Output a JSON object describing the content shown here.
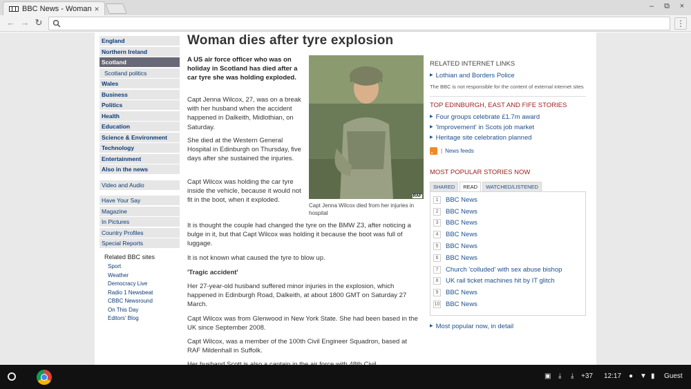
{
  "browser": {
    "tab_title": "BBC News - Woman dies after tyre explosion",
    "close_glyph": "×",
    "address": "",
    "window_controls": [
      "–",
      "⧉",
      "×"
    ]
  },
  "left_nav": {
    "sections": [
      {
        "label": "England",
        "style": "bold"
      },
      {
        "label": "Northern Ireland",
        "style": "bold"
      },
      {
        "label": "Scotland",
        "style": "active"
      },
      {
        "label": "Scotland politics",
        "style": "sub"
      },
      {
        "label": "Wales",
        "style": "bold"
      },
      {
        "label": "Business",
        "style": "bold"
      },
      {
        "label": "Politics",
        "style": "bold"
      },
      {
        "label": "Health",
        "style": "bold"
      },
      {
        "label": "Education",
        "style": "bold"
      },
      {
        "label": "Science & Environment",
        "style": "bold"
      },
      {
        "label": "Technology",
        "style": "bold"
      },
      {
        "label": "Entertainment",
        "style": "bold"
      },
      {
        "label": "Also in the news",
        "style": "bold"
      }
    ],
    "video_audio": "Video and Audio",
    "extras": [
      "Have Your Say",
      "Magazine",
      "In Pictures",
      "Country Profiles",
      "Special Reports"
    ],
    "related_head": "Related BBC sites",
    "related_sites": [
      "Sport",
      "Weather",
      "Democracy Live",
      "Radio 1 Newsbeat",
      "CBBC Newsround",
      "On This Day",
      "Editors' Blog"
    ]
  },
  "article": {
    "headline": "Woman dies after tyre explosion",
    "lead": "A US air force officer who was on holiday in Scotland has died after a car tyre she was holding exploded.",
    "paragraphs_narrow": [
      "Capt Jenna Wilcox, 27, was on a break with her husband when the accident happened in Dalkeith, Midlothian, on Saturday.",
      "She died at the Western General Hospital in Edinburgh on Thursday, five days after she sustained the injuries.",
      "Capt Wilcox was holding the car tyre inside the vehicle, because it would not fit in the boot, when it exploded."
    ],
    "paragraphs_wide": [
      "It is thought the couple had changed the tyre on the BMW Z3, after noticing a bulge in it, but that Capt Wilcox was holding it because the boot was full of luggage.",
      "It is not known what caused the tyre to blow up.",
      "'Tragic accident'",
      "Her 27-year-old husband suffered minor injuries in the explosion, which happened in Edinburgh Road, Dalkeith, at about 1800 GMT on Saturday 27 March.",
      "Capt Wilcox was from Glenwood in New York State. She had been based in the UK since September 2008.",
      "Capt Wilcox, was a member of the 100th Civil Engineer Squadron, based at RAF Mildenhall in Suffolk.",
      "Her husband Scott is also a captain in the air force with 48th Civil"
    ],
    "photo_credit": "RAF",
    "caption": "Capt Jenna Wilcox died from her injuries in hospital"
  },
  "right_col": {
    "related_links_head": "RELATED INTERNET LINKS",
    "related_links": [
      "Lothian and Borders Police"
    ],
    "disclaimer": "The BBC is not responsible for the content of external internet sites",
    "top_stories_head": "TOP EDINBURGH, EAST AND FIFE STORIES",
    "top_stories": [
      "Four groups celebrate £1.7m award",
      "'Improvement' in Scots job market",
      "Heritage site celebration planned"
    ],
    "feeds_sep": "|",
    "feeds_label": "News feeds",
    "popular_head": "MOST POPULAR STORIES NOW",
    "popular_tabs": [
      "SHARED",
      "READ",
      "WATCHED/LISTENED"
    ],
    "popular_tab_selected": "READ",
    "popular_items": [
      {
        "num": "1",
        "label": "BBC News"
      },
      {
        "num": "2",
        "label": "BBC News"
      },
      {
        "num": "3",
        "label": "BBC News"
      },
      {
        "num": "4",
        "label": "BBC News"
      },
      {
        "num": "5",
        "label": "BBC News"
      },
      {
        "num": "6",
        "label": "BBC News"
      },
      {
        "num": "7",
        "label": "Church 'colluded' with sex abuse bishop"
      },
      {
        "num": "8",
        "label": "UK rail ticket machines hit by IT glitch"
      },
      {
        "num": "9",
        "label": "BBC News"
      },
      {
        "num": "10",
        "label": "BBC News"
      }
    ],
    "popular_detail": "Most popular now, in detail"
  },
  "shelf": {
    "badge": "+37",
    "time": "12:17",
    "user": "Guest"
  },
  "colors": {
    "link": "#1d4f8c",
    "nav_text": "#0b3a75",
    "section_red": "#a02020",
    "nav_active_bg": "#686877"
  }
}
